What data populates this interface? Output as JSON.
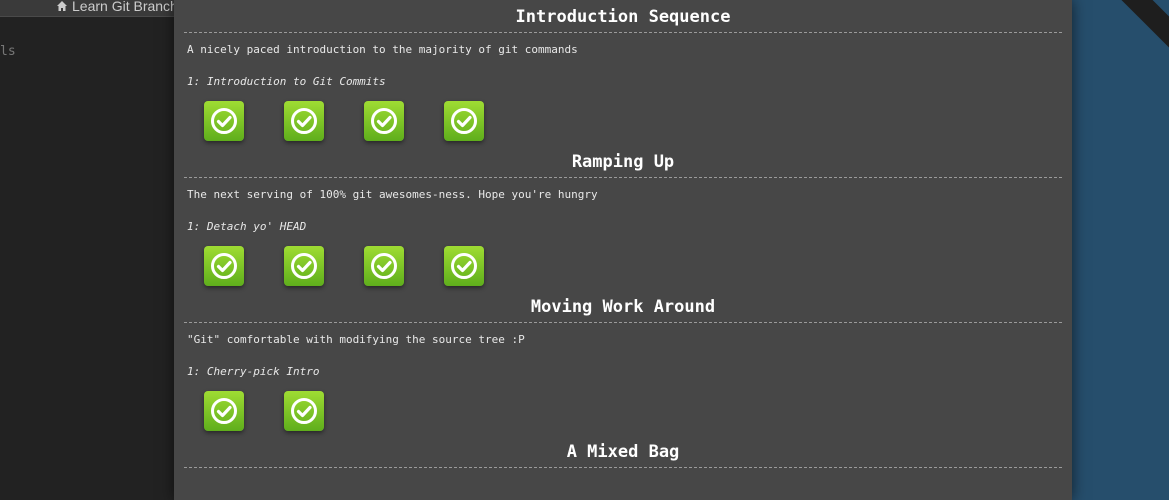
{
  "background_app": {
    "nav_title": "Learn Git Branch",
    "side_text": "ls"
  },
  "modal": {
    "sequences": [
      {
        "title": "Introduction Sequence",
        "description": "A nicely paced introduction to the majority of git commands",
        "selected_level": "1: Introduction to Git Commits",
        "levels_completed": 4
      },
      {
        "title": "Ramping Up",
        "description": "The next serving of 100% git awesomes-ness. Hope you're hungry",
        "selected_level": "1: Detach yo' HEAD",
        "levels_completed": 4
      },
      {
        "title": "Moving Work Around",
        "description": "\"Git\" comfortable with modifying the source tree :P",
        "selected_level": "1: Cherry-pick Intro",
        "levels_completed": 2
      },
      {
        "title": "A Mixed Bag"
      }
    ]
  },
  "colors": {
    "modal_bg": "#474747",
    "level_complete": "#7cc524",
    "right_panel": "#264e6c"
  },
  "icons": {
    "home": "home-icon",
    "level": "check-circle-icon"
  }
}
